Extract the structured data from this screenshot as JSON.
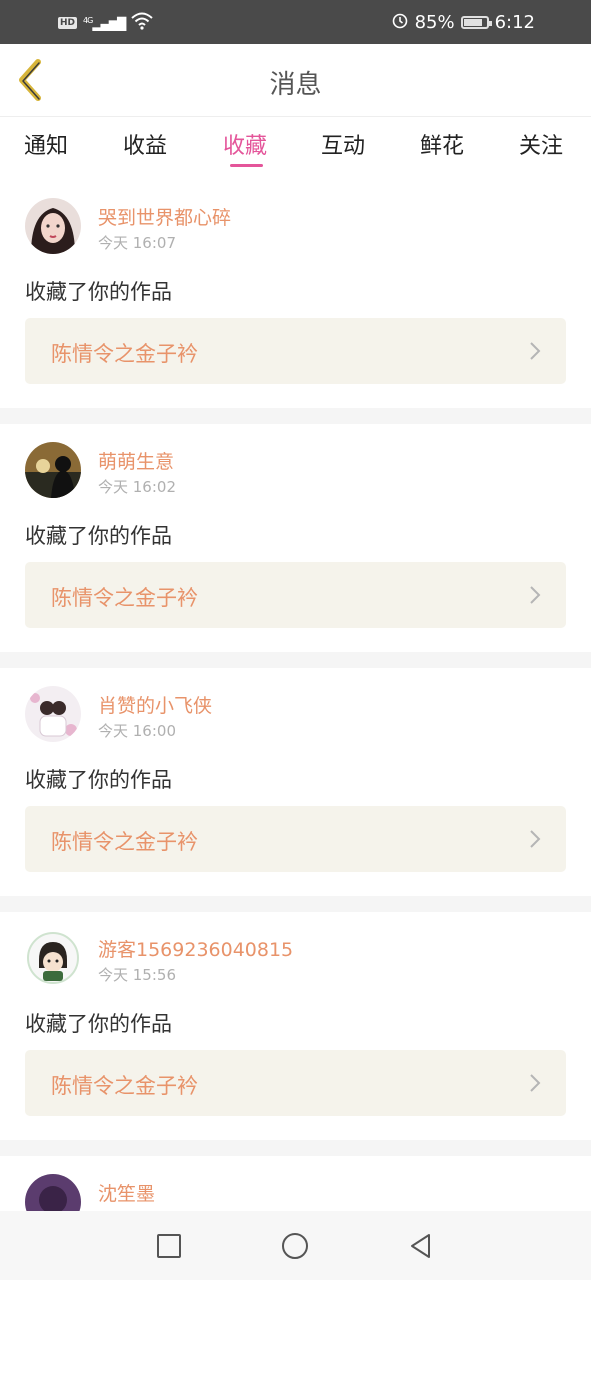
{
  "status_bar": {
    "network": "4G",
    "hd": "HD",
    "battery_percent": "85%",
    "battery_level": 0.85,
    "time": "6:12"
  },
  "header": {
    "title": "消息"
  },
  "tabs": [
    {
      "label": "通知"
    },
    {
      "label": "收益"
    },
    {
      "label": "收藏"
    },
    {
      "label": "互动"
    },
    {
      "label": "鲜花"
    },
    {
      "label": "关注"
    }
  ],
  "active_tab": "收藏",
  "colors": {
    "accent": "#e4559a",
    "username": "#e8936a",
    "work_bg": "#f5f3eb"
  },
  "items": [
    {
      "user": "哭到世界都心碎",
      "time": "今天 16:07",
      "message": "收藏了你的作品",
      "work": "陈情令之金子衿"
    },
    {
      "user": "萌萌生意",
      "time": "今天 16:02",
      "message": "收藏了你的作品",
      "work": "陈情令之金子衿"
    },
    {
      "user": "肖赞的小飞侠",
      "time": "今天 16:00",
      "message": "收藏了你的作品",
      "work": "陈情令之金子衿"
    },
    {
      "user": "游客1569236040815",
      "time": "今天 15:56",
      "message": "收藏了你的作品",
      "work": "陈情令之金子衿"
    },
    {
      "user": "沈笙墨",
      "time": "",
      "message": "",
      "work": ""
    }
  ]
}
